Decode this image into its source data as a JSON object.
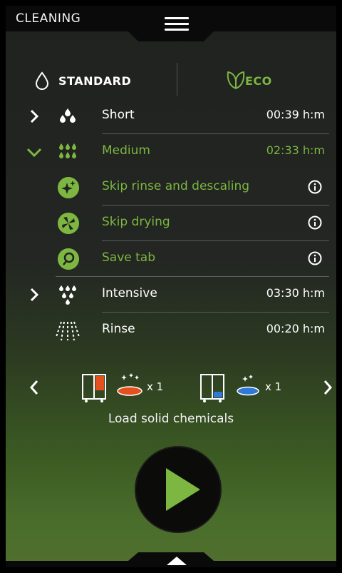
{
  "header": {
    "title": "CLEANING",
    "menu_icon": "hamburger-menu-icon"
  },
  "modes": [
    {
      "label": "STANDARD",
      "icon": "water-drop-icon",
      "selected": false
    },
    {
      "label": "ECO",
      "icon": "leaf-icon",
      "selected": true
    }
  ],
  "programs": [
    {
      "name": "Short",
      "time": "00:39 h:m",
      "icon": "small-drops-icon",
      "expanded": false
    },
    {
      "name": "Medium",
      "time": "02:33 h:m",
      "icon": "medium-drops-icon",
      "expanded": true
    },
    {
      "name": "Intensive",
      "time": "03:30 h:m",
      "icon": "many-drops-icon",
      "expanded": false
    },
    {
      "name": "Rinse",
      "time": "00:20 h:m",
      "icon": "shower-icon",
      "expanded": false
    }
  ],
  "options": [
    {
      "label": "Skip rinse and descaling",
      "icon": "sparkle-icon",
      "info_icon": "info-icon"
    },
    {
      "label": "Skip drying",
      "icon": "fan-icon",
      "info_icon": "info-icon"
    },
    {
      "label": "Save tab",
      "icon": "tab-icon",
      "info_icon": "info-icon"
    }
  ],
  "chemicals": {
    "items": [
      {
        "qty": "x 1",
        "color": "#e4501e",
        "icon": "detergent-tablet-icon"
      },
      {
        "qty": "x 1",
        "color": "#2f7ad9",
        "icon": "rinse-aid-tablet-icon"
      }
    ],
    "label": "Load solid chemicals"
  },
  "colors": {
    "accent": "#7db640",
    "bg": "#222420"
  },
  "start_icon": "play-icon",
  "footer_icon": "chevron-up-icon"
}
